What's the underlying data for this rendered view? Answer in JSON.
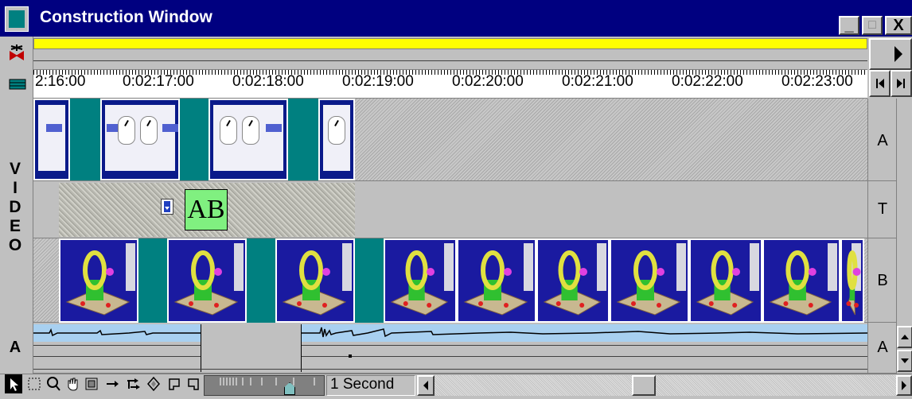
{
  "window": {
    "title": "Construction Window",
    "minimize": "_",
    "maximize": "□",
    "close": "X"
  },
  "timeline": {
    "ruler_labels": [
      "2:16:00",
      "0:02:17:00",
      "0:02:18:00",
      "0:02:19:00",
      "0:02:20:00",
      "0:02:21:00",
      "0:02:22:00",
      "0:02:23:00"
    ]
  },
  "tracks": {
    "video_label": [
      "V",
      "I",
      "D",
      "E",
      "O"
    ],
    "video_a": "A",
    "transition": "T",
    "video_b": "B",
    "audio_label": "A",
    "audio_right": "A",
    "transition_icon_text": "AB"
  },
  "toolbar": {
    "time_unit": "1 Second",
    "tools": [
      "selection-tool",
      "range-select-tool",
      "zoom-tool",
      "hand-tool",
      "block-select-tool",
      "track-select-tool",
      "multitrack-select-tool",
      "razor-tool",
      "in-point-tool",
      "out-point-tool"
    ]
  },
  "colors": {
    "title_bg": "#000080",
    "work_area_bar": "#ffff00",
    "clip_teal": "#008080",
    "audio_track": "#a8d0f0",
    "face": "#c0c0c0"
  }
}
